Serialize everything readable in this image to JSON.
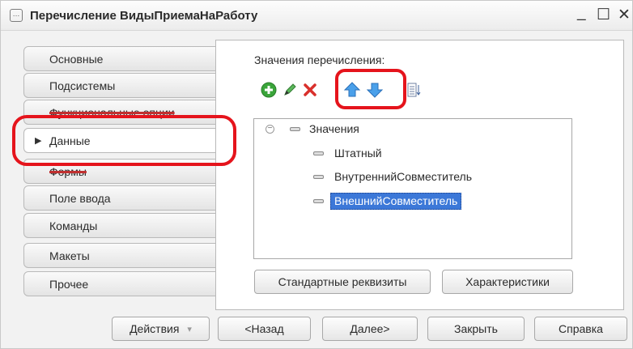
{
  "window": {
    "title": "Перечисление ВидыПриемаНаРаботу",
    "title_icon": "…",
    "minimize_glyph": "_",
    "maximize_glyph": "☐",
    "close_glyph": "✕"
  },
  "tabs": [
    {
      "label": "Основные"
    },
    {
      "label": "Подсистемы"
    },
    {
      "label": "Функциональные опции"
    },
    {
      "label": "Данные",
      "active": true
    },
    {
      "label": "Формы"
    },
    {
      "label": "Поле ввода"
    },
    {
      "label": "Команды"
    },
    {
      "label": "Макеты"
    },
    {
      "label": "Прочее"
    }
  ],
  "content": {
    "label": "Значения перечисления:",
    "toolbar_icons": [
      "add-icon",
      "edit-icon",
      "delete-icon",
      "move-up-icon",
      "move-down-icon",
      "sort-icon"
    ],
    "tree": {
      "root": "Значения",
      "items": [
        "Штатный",
        "ВнутреннийСовместитель",
        "ВнешнийСовместитель"
      ],
      "selected": "ВнешнийСовместитель"
    },
    "buttons": {
      "standard_attributes": "Стандартные реквизиты",
      "characteristics": "Характеристики"
    }
  },
  "footer": {
    "actions": "Действия",
    "actions_arrow": "▾",
    "back": "<Назад",
    "next": "Далее>",
    "close": "Закрыть",
    "help": "Справка"
  },
  "colors": {
    "highlight": "#e5141c",
    "selection": "#3c78d8",
    "add": "#3aa53a",
    "delete": "#d9302c",
    "arrows": "#3b8fe0"
  }
}
